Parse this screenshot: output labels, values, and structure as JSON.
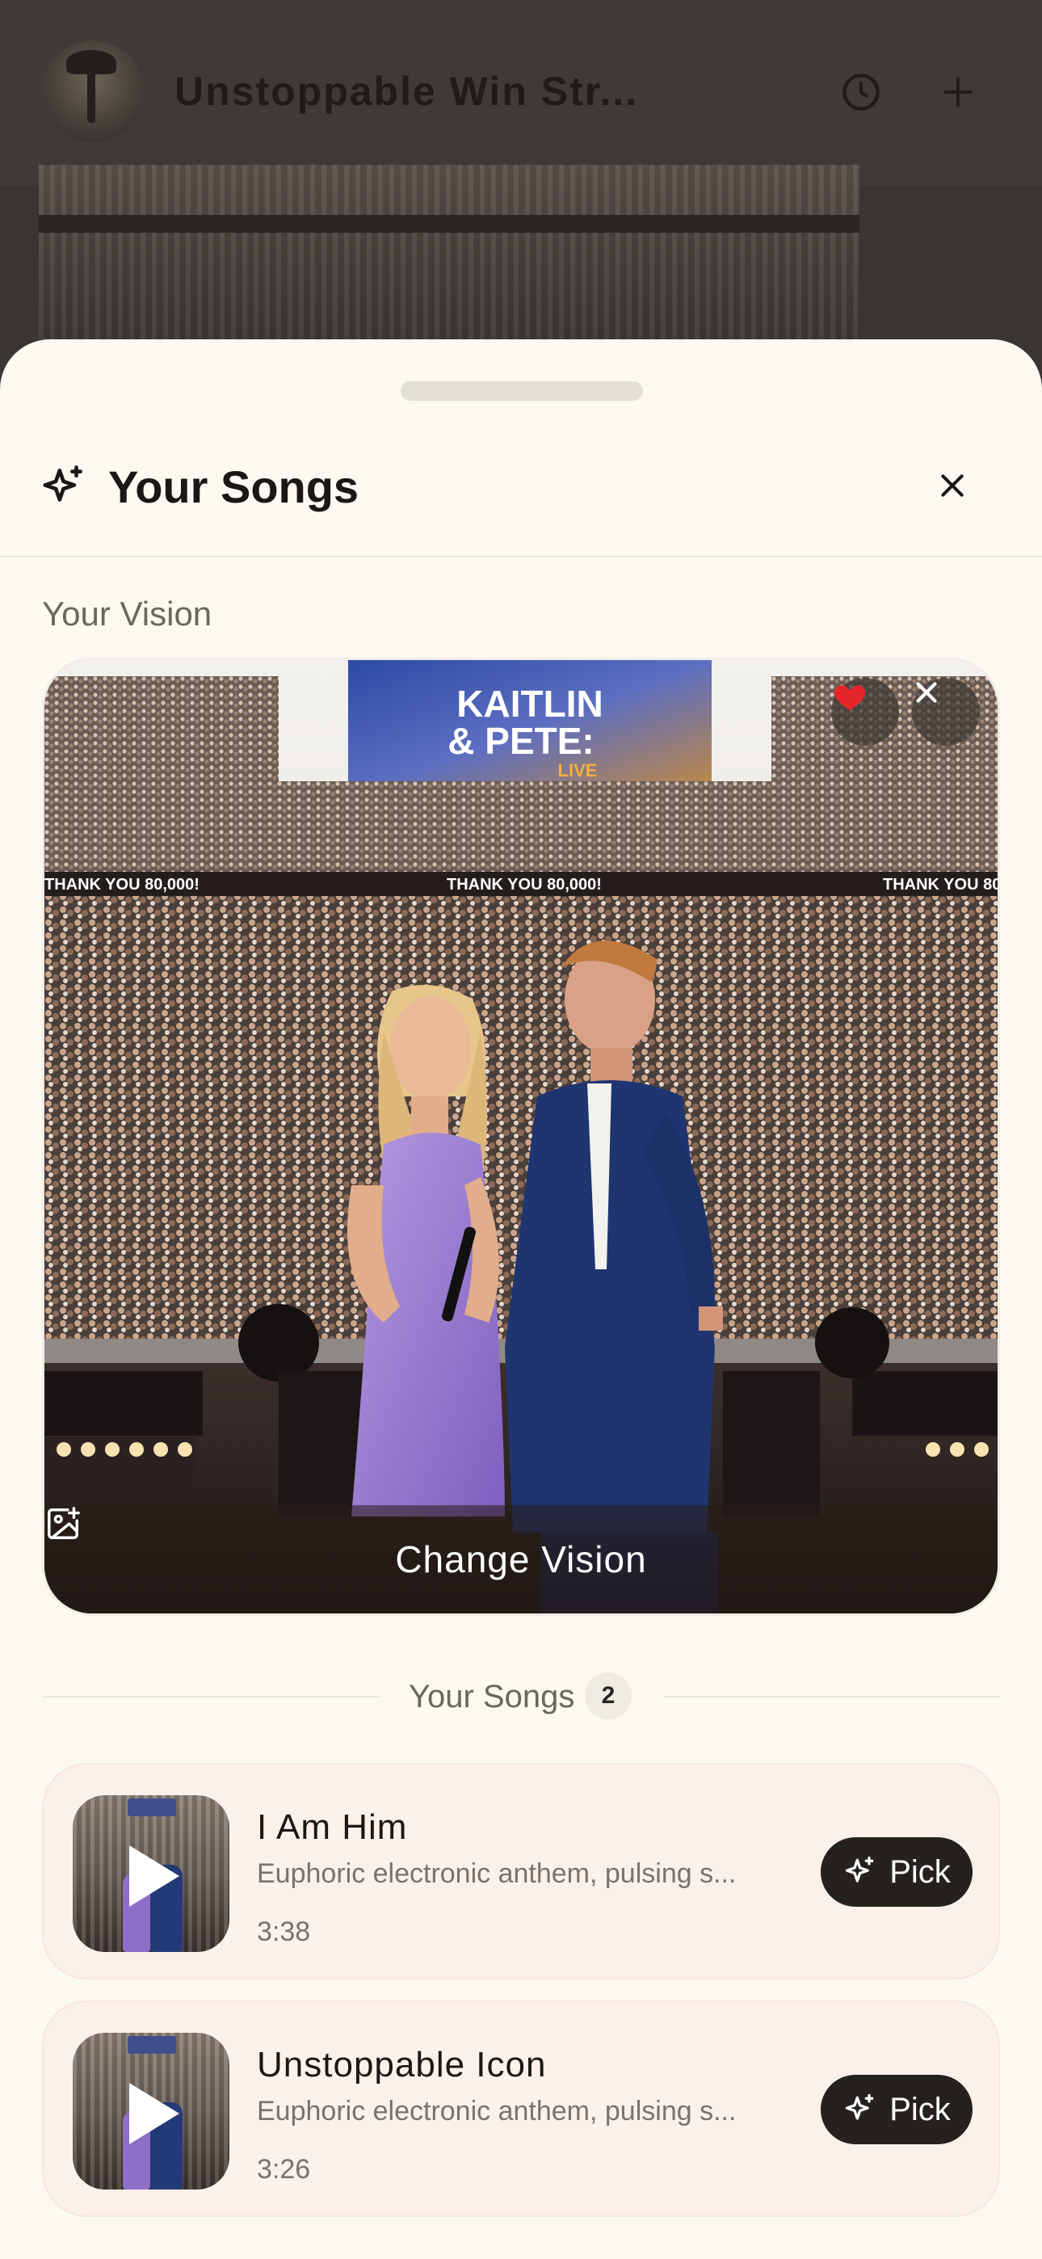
{
  "background": {
    "title": "Unstoppable Win Str...",
    "history_icon": "clock-icon",
    "add_icon": "plus-icon"
  },
  "sheet": {
    "title": "Your Songs",
    "title_icon": "sparkle-icon",
    "close_icon": "close-icon"
  },
  "vision": {
    "section_label": "Your Vision",
    "stage_screen_text_line1": "KAITLIN",
    "stage_screen_text_line2": "& PETE:",
    "stage_screen_text_line3": "LIVE",
    "banner_text": "THANK YOU 80,000!",
    "change_label": "Change Vision",
    "favorited": true
  },
  "songs": {
    "section_label": "Your Songs",
    "count": "2",
    "items": [
      {
        "title": "I Am Him",
        "description": "Euphoric electronic anthem, pulsing s...",
        "duration": "3:38",
        "action": "Pick"
      },
      {
        "title": "Unstoppable Icon",
        "description": "Euphoric electronic anthem, pulsing s...",
        "duration": "3:26",
        "action": "Pick"
      }
    ]
  },
  "colors": {
    "sheet_bg": "#fcf8f2",
    "card_bg": "#fcf1ea",
    "button_dark": "#25211f",
    "heart_red": "#e5262a",
    "dress_purple": "#9a7bd2",
    "suit_navy": "#1f3570"
  }
}
